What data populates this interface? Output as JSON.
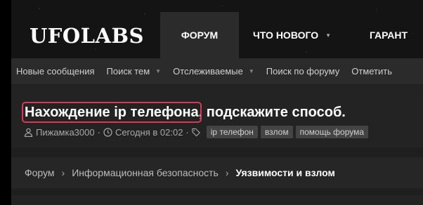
{
  "logo": "UFOLABS",
  "nav": {
    "forum": "ФОРУМ",
    "whats_new": "ЧТО НОВОГО",
    "garant": "ГАРАНТ"
  },
  "subnav": {
    "items": [
      "Новые сообщения",
      "Поиск тем",
      "Отслеживаемые",
      "Поиск по форуму",
      "Отметить"
    ]
  },
  "thread": {
    "title_highlight": "Нахождение ip телефона",
    "title_rest": ", подскажите способ.",
    "author": "Пижамка3000",
    "date": "Сегодня в 02:02",
    "tags": [
      "ip телефон",
      "взлом",
      "помощь форума"
    ]
  },
  "breadcrumb": [
    "Форум",
    "Информационная безопасность",
    "Уязвимости и взлом"
  ],
  "colors": {
    "highlight": "#e0335a",
    "background": "#1f1f1f"
  }
}
